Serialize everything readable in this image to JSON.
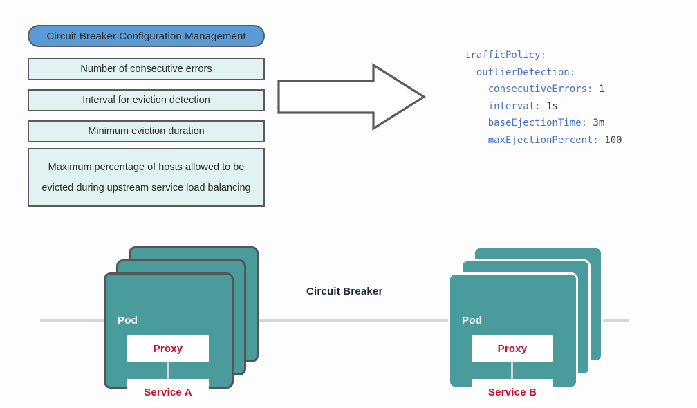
{
  "config_panel": {
    "title": "Circuit Breaker Configuration Management",
    "items": [
      "Number of consecutive errors",
      "Interval for eviction detection",
      "Minimum eviction duration",
      "Maximum percentage of hosts allowed to be evicted during upstream service load balancing"
    ]
  },
  "arrow": {
    "name": "right-arrow",
    "direction": "right"
  },
  "yaml": {
    "lines": [
      {
        "indent": 0,
        "key": "trafficPolicy:",
        "value": ""
      },
      {
        "indent": 1,
        "key": "outlierDetection:",
        "value": ""
      },
      {
        "indent": 2,
        "key": "consecutiveErrors:",
        "value": "1"
      },
      {
        "indent": 2,
        "key": "interval:",
        "value": "1s"
      },
      {
        "indent": 2,
        "key": "baseEjectionTime:",
        "value": "3m"
      },
      {
        "indent": 2,
        "key": "maxEjectionPercent:",
        "value": "100"
      }
    ],
    "l0": "trafficPolicy:",
    "l1": "  outlierDetection:",
    "l2_k": "    consecutiveErrors:",
    "l2_v": " 1",
    "l3_k": "    interval:",
    "l3_v": " 1s",
    "l4_k": "    baseEjectionTime:",
    "l4_v": " 3m",
    "l5_k": "    maxEjectionPercent:",
    "l5_v": " 100"
  },
  "flow": {
    "label": "Circuit Breaker"
  },
  "pod_left": {
    "pod_label": "Pod",
    "proxy_label": "Proxy",
    "service_label": "Service A"
  },
  "pod_right": {
    "pod_label": "Pod",
    "proxy_label": "Proxy",
    "service_label": "Service B"
  },
  "colors": {
    "pill_blue": "#5B9BD5",
    "box_mint": "#E0F2F1",
    "box_border": "#5a5a5a",
    "pod_teal": "#4a9b9b",
    "service_red": "#C8102E",
    "yaml_key_blue": "#4472C4",
    "yaml_value": "#3f3f3f",
    "line_gray": "#d6d6d6"
  }
}
